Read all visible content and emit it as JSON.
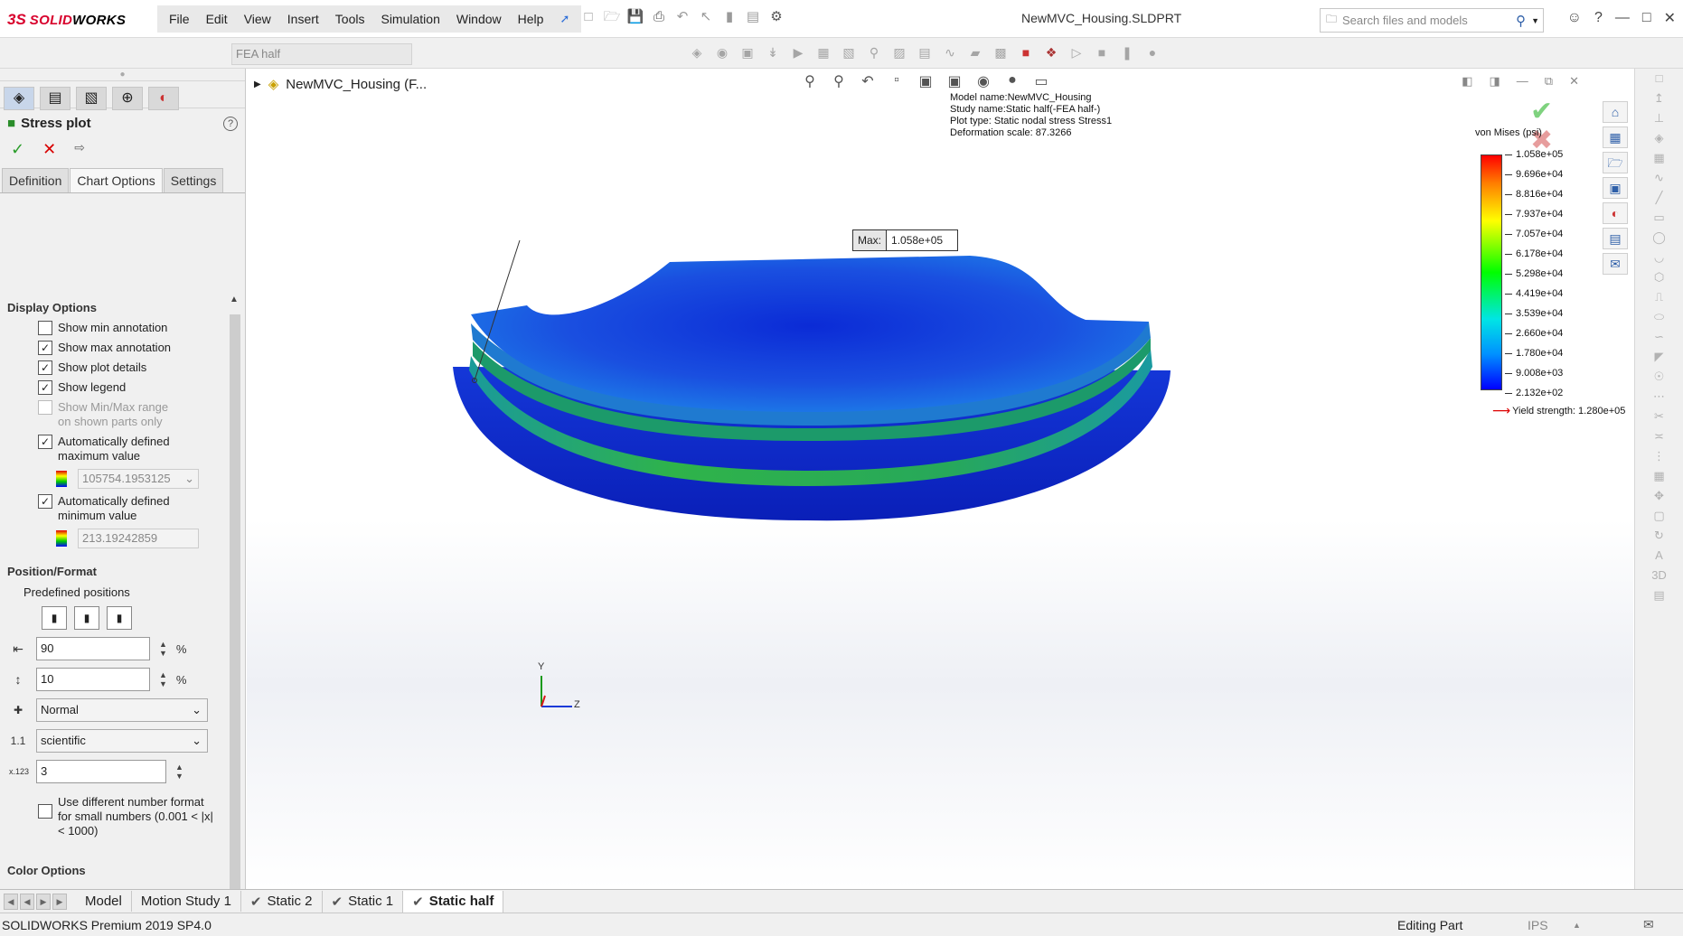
{
  "app": {
    "brand_prefix": "3S",
    "brand_name": "SOLID",
    "brand_suffix": "WORKS",
    "document_title": "NewMVC_Housing.SLDPRT",
    "menu": [
      "File",
      "Edit",
      "View",
      "Insert",
      "Tools",
      "Simulation",
      "Window",
      "Help"
    ]
  },
  "search": {
    "placeholder": "Search files and models"
  },
  "toolbar": {
    "config_name": "FEA half"
  },
  "panel": {
    "title": "Stress plot",
    "tabs": [
      "Definition",
      "Chart Options",
      "Settings"
    ],
    "active_tab": "Chart Options",
    "display_options": {
      "header": "Display Options",
      "items": [
        {
          "label": "Show min annotation",
          "checked": false,
          "enabled": true
        },
        {
          "label": "Show max annotation",
          "checked": true,
          "enabled": true
        },
        {
          "label": "Show plot details",
          "checked": true,
          "enabled": true
        },
        {
          "label": "Show legend",
          "checked": true,
          "enabled": true
        },
        {
          "label": "Show Min/Max range on shown parts only",
          "checked": false,
          "enabled": false
        },
        {
          "label": "Automatically defined maximum value",
          "checked": true,
          "enabled": true
        },
        {
          "label": "Automatically defined minimum value",
          "checked": true,
          "enabled": true
        }
      ],
      "max_value": "105754.1953125",
      "min_value": "213.19242859"
    },
    "position_format": {
      "header": "Position/Format",
      "predefined_label": "Predefined positions",
      "x_percent": "90",
      "y_percent": "10",
      "unit": "%",
      "orientation": "Normal",
      "number_format": "scientific",
      "decimals": "3",
      "small_numbers_label": "Use different number format for small numbers (0.001 < |x| < 1000)",
      "small_numbers_checked": false
    },
    "color_options": {
      "header": "Color Options"
    }
  },
  "viewport": {
    "tree_label": "NewMVC_Housing  (F...",
    "info_lines": [
      "Model name:NewMVC_Housing",
      "Study name:Static half(-FEA half-)",
      "Plot type: Static nodal stress Stress1",
      "Deformation scale: 87.3266"
    ],
    "legend_title": "von Mises (psi)",
    "legend_ticks": [
      "1.058e+05",
      "9.696e+04",
      "8.816e+04",
      "7.937e+04",
      "7.057e+04",
      "6.178e+04",
      "5.298e+04",
      "4.419e+04",
      "3.539e+04",
      "2.660e+04",
      "1.780e+04",
      "9.008e+03",
      "2.132e+02"
    ],
    "yield_label": "Yield strength: 1.280e+05",
    "max_label": "Max:",
    "max_value": "1.058e+05",
    "axis_y": "Y",
    "axis_z": "Z"
  },
  "bottom_tabs": [
    "Model",
    "Motion Study 1",
    "Static 2",
    "Static 1",
    "Static half"
  ],
  "active_bottom_tab": "Static half",
  "status": {
    "product": "SOLIDWORKS Premium 2019 SP4.0",
    "mode": "Editing Part",
    "units": "IPS"
  },
  "colors": {
    "brand_red": "#d8002c",
    "accept_green": "#2a9d2a",
    "cancel_red": "#d80000"
  }
}
